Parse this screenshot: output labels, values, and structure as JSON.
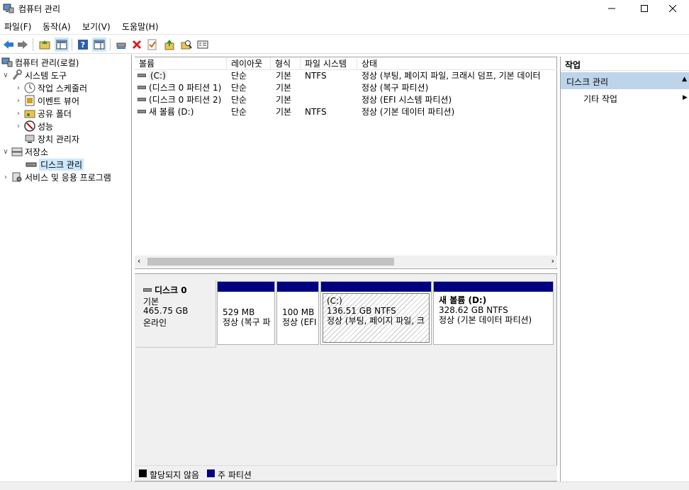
{
  "window": {
    "title": "컴퓨터 관리"
  },
  "menu": [
    "파일(F)",
    "동작(A)",
    "보기(V)",
    "도움말(H)"
  ],
  "tree": {
    "root": "컴퓨터 관리(로컬)",
    "system_tools": "시스템 도구",
    "task_scheduler": "작업 스케줄러",
    "event_viewer": "이벤트 뷰어",
    "shared_folders": "공유 폴더",
    "performance": "성능",
    "device_manager": "장치 관리자",
    "storage": "저장소",
    "disk_management": "디스크 관리",
    "services": "서비스 및 응용 프로그램"
  },
  "volume_list": {
    "columns": [
      "볼륨",
      "레이아웃",
      "형식",
      "파일 시스템",
      "상태"
    ],
    "rows": [
      {
        "volume": "(C:)",
        "layout": "단순",
        "type": "기본",
        "fs": "NTFS",
        "status": "정상 (부팅, 페이지 파일, 크래시 덤프, 기본 데이터"
      },
      {
        "volume": "(디스크 0 파티션 1)",
        "layout": "단순",
        "type": "기본",
        "fs": "",
        "status": "정상 (복구 파티션)"
      },
      {
        "volume": "(디스크 0 파티션 2)",
        "layout": "단순",
        "type": "기본",
        "fs": "",
        "status": "정상 (EFI 시스템 파티션)"
      },
      {
        "volume": "새 볼륨 (D:)",
        "layout": "단순",
        "type": "기본",
        "fs": "NTFS",
        "status": "정상 (기본 데이터 파티션)"
      }
    ]
  },
  "disk": {
    "name": "디스크 0",
    "kind": "기본",
    "size": "465.75 GB",
    "state": "온라인",
    "partitions": [
      {
        "label": "",
        "size": "529 MB",
        "status": "정상 (복구 파"
      },
      {
        "label": "",
        "size": "100 MB",
        "status": "정상 (EFI"
      },
      {
        "label": "(C:)",
        "size": "136.51 GB NTFS",
        "status": "정상 (부팅, 페이지 파일, 크"
      },
      {
        "label": "새 볼륨  (D:)",
        "size": "328.62 GB NTFS",
        "status": "정상 (기본 데이터 파티션)"
      }
    ]
  },
  "legend": {
    "unallocated": "할당되지 않음",
    "primary": "주 파티션"
  },
  "actions": {
    "header": "작업",
    "section": "디스크 관리",
    "item": "기타 작업"
  },
  "colors": {
    "primary_partition": "#000080",
    "unallocated": "#000000",
    "selection": "#cce8ff",
    "action_section": "#bed4ea"
  }
}
